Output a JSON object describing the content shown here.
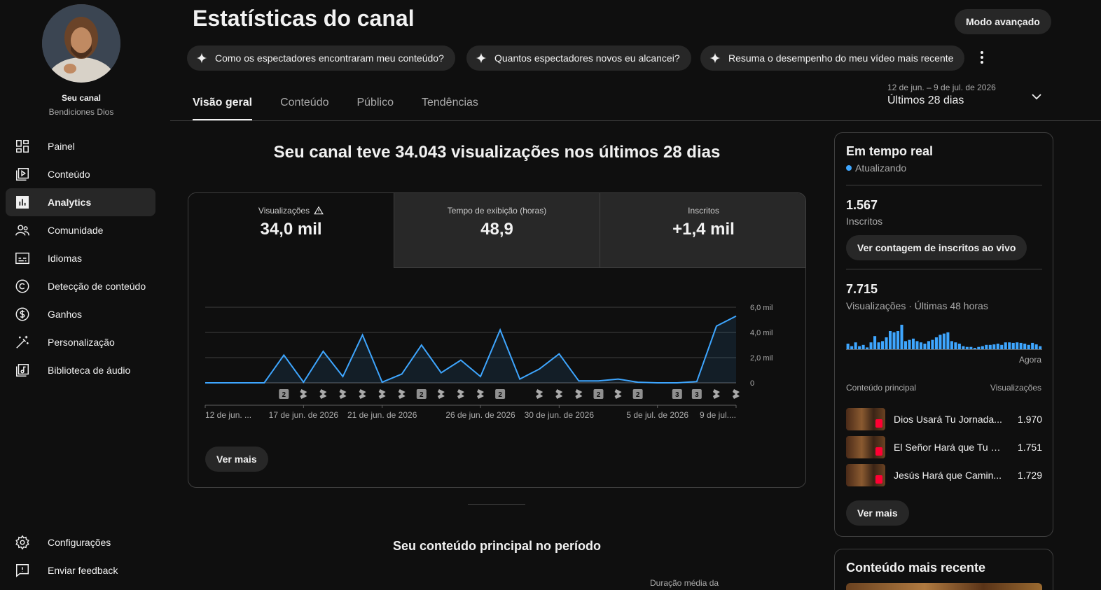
{
  "sidebar": {
    "channel_name": "Seu canal",
    "channel_handle": "Bendiciones Dios",
    "items": [
      {
        "label": "Painel",
        "icon": "dashboard-icon"
      },
      {
        "label": "Conteúdo",
        "icon": "content-icon"
      },
      {
        "label": "Analytics",
        "icon": "analytics-icon",
        "active": true
      },
      {
        "label": "Comunidade",
        "icon": "community-icon"
      },
      {
        "label": "Idiomas",
        "icon": "subtitles-icon"
      },
      {
        "label": "Detecção de conteúdo",
        "icon": "copyright-icon"
      },
      {
        "label": "Ganhos",
        "icon": "dollar-icon"
      },
      {
        "label": "Personalização",
        "icon": "magic-wand-icon"
      },
      {
        "label": "Biblioteca de áudio",
        "icon": "audio-library-icon"
      }
    ],
    "footer_items": [
      {
        "label": "Configurações",
        "icon": "settings-icon"
      },
      {
        "label": "Enviar feedback",
        "icon": "feedback-icon"
      }
    ]
  },
  "header": {
    "title": "Estatísticas do canal",
    "advanced_mode": "Modo avançado",
    "chips": [
      "Como os espectadores encontraram meu conteúdo?",
      "Quantos espectadores novos eu alcancei?",
      "Resuma o desempenho do meu vídeo mais recente"
    ],
    "tabs": [
      "Visão geral",
      "Conteúdo",
      "Público",
      "Tendências"
    ],
    "date_range": {
      "sub": "12 de jun. – 9 de jul. de 2026",
      "main": "Últimos 28 dias"
    }
  },
  "overview": {
    "headline": "Seu canal teve 34.043 visualizações nos últimos 28 dias",
    "metrics": [
      {
        "label": "Visualizações",
        "value": "34,0 mil",
        "warning": true
      },
      {
        "label": "Tempo de exibição (horas)",
        "value": "48,9"
      },
      {
        "label": "Inscritos",
        "value": "+1,4 mil"
      }
    ],
    "ver_mais": "Ver mais",
    "top_content_title": "Seu conteúdo principal no período",
    "col_header": "Duração média da"
  },
  "chart_data": {
    "type": "area",
    "x": [
      1,
      2,
      3,
      4,
      5,
      6,
      7,
      8,
      9,
      10,
      11,
      12,
      13,
      14,
      15,
      16,
      17,
      18,
      19,
      20,
      21,
      22,
      23,
      24,
      25,
      26,
      27,
      28
    ],
    "values": [
      0,
      0,
      0,
      0,
      2200,
      50,
      2500,
      500,
      3800,
      50,
      700,
      3000,
      800,
      1800,
      500,
      4200,
      300,
      1100,
      2300,
      150,
      150,
      300,
      50,
      0,
      0,
      100,
      4500,
      5300
    ],
    "ylim": [
      0,
      6000
    ],
    "ytick_labels": [
      "0",
      "2,0 mil",
      "4,0 mil",
      "6,0 mil"
    ],
    "xtick_labels": [
      {
        "label": "12 de jun. ...",
        "index": 1
      },
      {
        "label": "17 de jun. de 2026",
        "index": 6
      },
      {
        "label": "21 de jun. de 2026",
        "index": 10
      },
      {
        "label": "26 de jun. de 2026",
        "index": 15
      },
      {
        "label": "30 de jun. de 2026",
        "index": 19
      },
      {
        "label": "5 de jul. de 2026",
        "index": 24
      },
      {
        "label": "9 de jul....",
        "index": 28
      }
    ],
    "markers": [
      {
        "index": 5,
        "kind": "count",
        "count": "2"
      },
      {
        "index": 6,
        "kind": "shorts"
      },
      {
        "index": 7,
        "kind": "shorts"
      },
      {
        "index": 8,
        "kind": "shorts"
      },
      {
        "index": 9,
        "kind": "shorts"
      },
      {
        "index": 10,
        "kind": "shorts"
      },
      {
        "index": 11,
        "kind": "shorts"
      },
      {
        "index": 12,
        "kind": "count",
        "count": "2"
      },
      {
        "index": 13,
        "kind": "shorts"
      },
      {
        "index": 14,
        "kind": "shorts"
      },
      {
        "index": 15,
        "kind": "shorts"
      },
      {
        "index": 16,
        "kind": "count",
        "count": "2"
      },
      {
        "index": 18,
        "kind": "shorts"
      },
      {
        "index": 19,
        "kind": "shorts"
      },
      {
        "index": 20,
        "kind": "shorts"
      },
      {
        "index": 21,
        "kind": "count",
        "count": "2"
      },
      {
        "index": 22,
        "kind": "shorts"
      },
      {
        "index": 23,
        "kind": "count",
        "count": "2"
      },
      {
        "index": 25,
        "kind": "count",
        "count": "3"
      },
      {
        "index": 26,
        "kind": "count",
        "count": "3"
      },
      {
        "index": 27,
        "kind": "shorts"
      },
      {
        "index": 28,
        "kind": "shorts"
      }
    ],
    "line_color": "#3ea6ff",
    "grid": true
  },
  "realtime": {
    "title": "Em tempo real",
    "status": "Atualizando",
    "subscribers_value": "1.567",
    "subscribers_label": "Inscritos",
    "live_count_button": "Ver contagem de inscritos ao vivo",
    "views_value": "7.715",
    "views_label": "Visualizações · Últimas 48 horas",
    "bars": [
      0.25,
      0.15,
      0.3,
      0.15,
      0.2,
      0.1,
      0.3,
      0.55,
      0.3,
      0.35,
      0.5,
      0.75,
      0.7,
      0.75,
      1.0,
      0.35,
      0.4,
      0.45,
      0.35,
      0.3,
      0.25,
      0.35,
      0.4,
      0.5,
      0.6,
      0.65,
      0.7,
      0.35,
      0.3,
      0.25,
      0.15,
      0.12,
      0.12,
      0.08,
      0.12,
      0.15,
      0.2,
      0.2,
      0.22,
      0.25,
      0.2,
      0.3,
      0.3,
      0.28,
      0.3,
      0.28,
      0.25,
      0.2,
      0.28,
      0.22,
      0.15
    ],
    "now_label": "Agora",
    "table_head_left": "Conteúdo principal",
    "table_head_right": "Visualizações",
    "rows": [
      {
        "title": "Dios Usará Tu Jornada...",
        "views": "1.970"
      },
      {
        "title": "El Señor Hará que Tu D...",
        "views": "1.751"
      },
      {
        "title": "Jesús Hará que Camin...",
        "views": "1.729"
      }
    ],
    "ver_mais": "Ver mais"
  },
  "recent": {
    "title": "Conteúdo mais recente"
  },
  "colors": {
    "accent": "#3ea6ff",
    "background": "#0f0f0f",
    "surface": "#272727",
    "shorts_red": "#ff0033"
  }
}
